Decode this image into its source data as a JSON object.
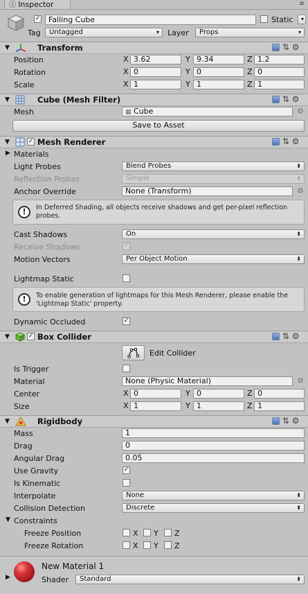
{
  "window": {
    "tab_label": "Inspector",
    "lock_icon": "lock-icon",
    "menu_icon": "menu-icon"
  },
  "object": {
    "name": "Falling Cube",
    "active": true,
    "static_label": "Static",
    "static": false,
    "tag_label": "Tag",
    "tag_value": "Untagged",
    "layer_label": "Layer",
    "layer_value": "Props"
  },
  "transform": {
    "title": "Transform",
    "rows": [
      {
        "label": "Position",
        "x": "3.62",
        "y": "9.34",
        "z": "1.2"
      },
      {
        "label": "Rotation",
        "x": "0",
        "y": "0",
        "z": "0"
      },
      {
        "label": "Scale",
        "x": "1",
        "y": "1",
        "z": "1"
      }
    ],
    "axis": {
      "x": "X",
      "y": "Y",
      "z": "Z"
    }
  },
  "mesh_filter": {
    "title": "Cube (Mesh Filter)",
    "mesh_label": "Mesh",
    "mesh_value": "Cube",
    "save_button": "Save to Asset"
  },
  "mesh_renderer": {
    "title": "Mesh Renderer",
    "enabled": true,
    "materials_label": "Materials",
    "light_probes_label": "Light Probes",
    "light_probes_value": "Blend Probes",
    "reflection_probes_label": "Reflection Probes",
    "reflection_probes_value": "Simple",
    "anchor_override_label": "Anchor Override",
    "anchor_override_value": "None (Transform)",
    "help_deferred_line1": "In Deferred Shading, all objects receive shadows and get per-pixel reflection",
    "help_deferred_line2": "probes.",
    "cast_shadows_label": "Cast Shadows",
    "cast_shadows_value": "On",
    "receive_shadows_label": "Receive Shadows",
    "receive_shadows": true,
    "motion_vectors_label": "Motion Vectors",
    "motion_vectors_value": "Per Object Motion",
    "lightmap_static_label": "Lightmap Static",
    "lightmap_static": false,
    "help_lightmap_line1": "To enable generation of lightmaps for this Mesh Renderer, please enable the",
    "help_lightmap_line2": "'Lightmap Static' property.",
    "dynamic_occluded_label": "Dynamic Occluded",
    "dynamic_occluded": true
  },
  "box_collider": {
    "title": "Box Collider",
    "enabled": true,
    "edit_collider_label": "Edit Collider",
    "is_trigger_label": "Is Trigger",
    "is_trigger": false,
    "material_label": "Material",
    "material_value": "None (Physic Material)",
    "center": {
      "label": "Center",
      "x": "0",
      "y": "0",
      "z": "0"
    },
    "size": {
      "label": "Size",
      "x": "1",
      "y": "1",
      "z": "1"
    }
  },
  "rigidbody": {
    "title": "Rigidbody",
    "mass_label": "Mass",
    "mass_value": "1",
    "drag_label": "Drag",
    "drag_value": "0",
    "angular_drag_label": "Angular Drag",
    "angular_drag_value": "0.05",
    "use_gravity_label": "Use Gravity",
    "use_gravity": true,
    "is_kinematic_label": "Is Kinematic",
    "is_kinematic": false,
    "interpolate_label": "Interpolate",
    "interpolate_value": "None",
    "collision_detection_label": "Collision Detection",
    "collision_detection_value": "Discrete",
    "constraints_label": "Constraints",
    "freeze_position_label": "Freeze Position",
    "freeze_rotation_label": "Freeze Rotation",
    "axis": {
      "x": "X",
      "y": "Y",
      "z": "Z"
    }
  },
  "material": {
    "name": "New Material 1",
    "shader_label": "Shader",
    "shader_value": "Standard"
  },
  "colors": {
    "background": "#c2c2c2",
    "header": "#cbcbcb",
    "field": "#f0f0f0",
    "material_red": "#c8262b"
  }
}
